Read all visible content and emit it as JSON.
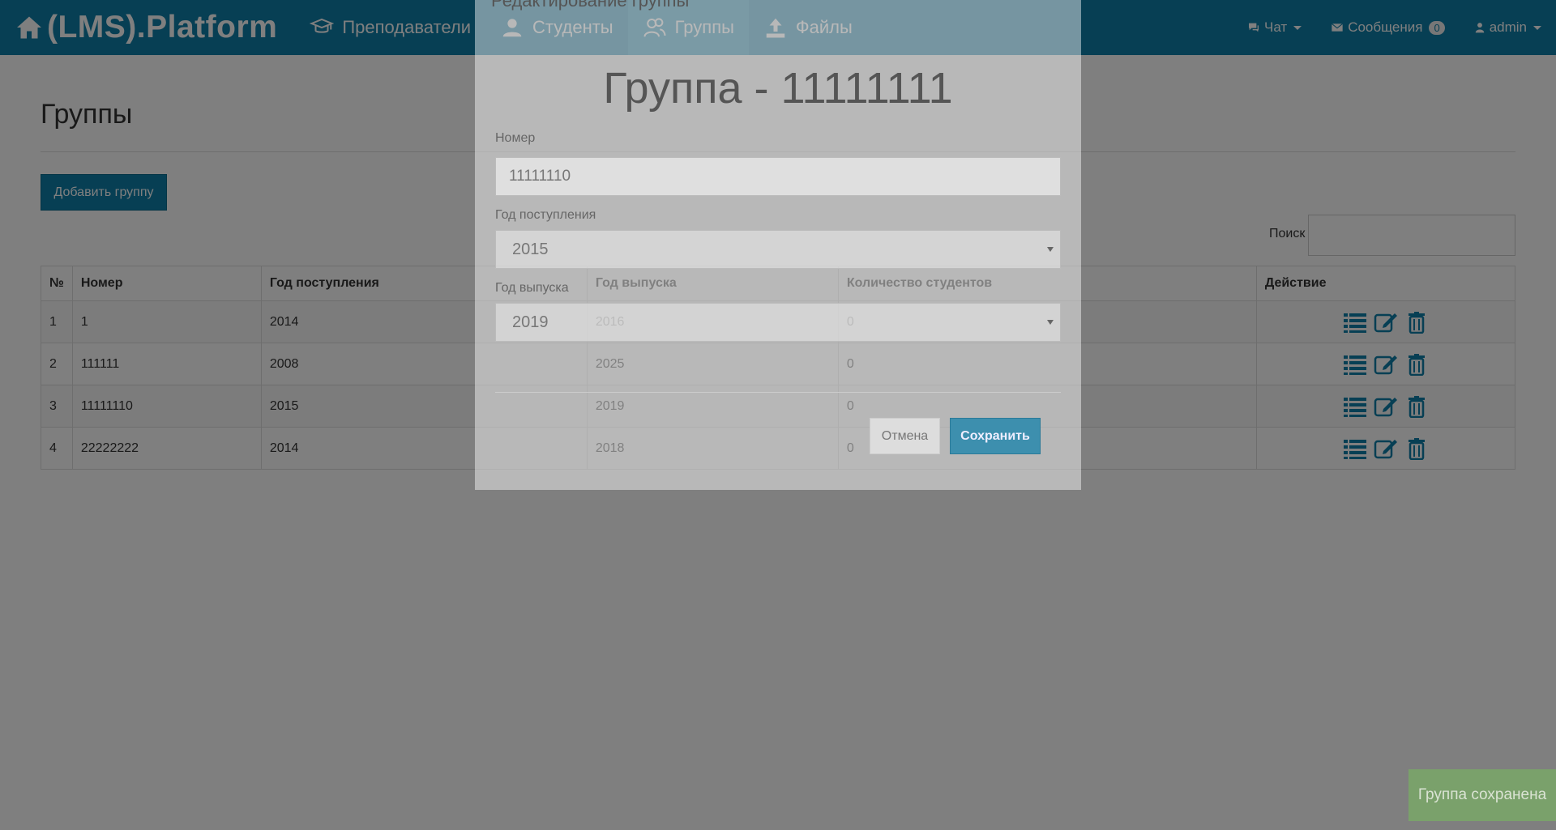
{
  "navbar": {
    "brand": "(LMS).Platform",
    "links": [
      {
        "label": "Преподаватели",
        "icon": "graduation-cap-icon"
      },
      {
        "label": "Студенты",
        "icon": "student-icon"
      },
      {
        "label": "Группы",
        "icon": "users-icon"
      },
      {
        "label": "Файлы",
        "icon": "upload-icon"
      }
    ],
    "chat_label": "Чат",
    "messages_label": "Сообщения",
    "messages_count": "0",
    "user_label": "admin",
    "colors": {
      "primary": "#0f7fa8",
      "active": "#1b8fb9"
    }
  },
  "page": {
    "title": "Группы",
    "add_button": "Добавить группу",
    "search_label": "Поиск",
    "search_value": ""
  },
  "table": {
    "headers": [
      "№",
      "Номер",
      "Год поступления",
      "Год выпуска",
      "Количество студентов",
      "Действие"
    ],
    "rows": [
      {
        "num": "1",
        "number": "1",
        "entry": "2014",
        "grad": "2016",
        "count": "0"
      },
      {
        "num": "2",
        "number": "111111",
        "entry": "2008",
        "grad": "2025",
        "count": "0"
      },
      {
        "num": "3",
        "number": "11111110",
        "entry": "2015",
        "grad": "2019",
        "count": "0"
      },
      {
        "num": "4",
        "number": "22222222",
        "entry": "2014",
        "grad": "2018",
        "count": "0"
      }
    ]
  },
  "modal": {
    "header": "Редактирование группы",
    "title": "Группа - 11111111",
    "number_label": "Номер",
    "number_value": "11111110",
    "entry_label": "Год поступления",
    "entry_value": "2015",
    "grad_label": "Год выпуска",
    "grad_value": "2019",
    "cancel_label": "Отмена",
    "save_label": "Сохранить"
  },
  "toast": {
    "text": "Группа сохранена",
    "color": "#7aa36a"
  }
}
